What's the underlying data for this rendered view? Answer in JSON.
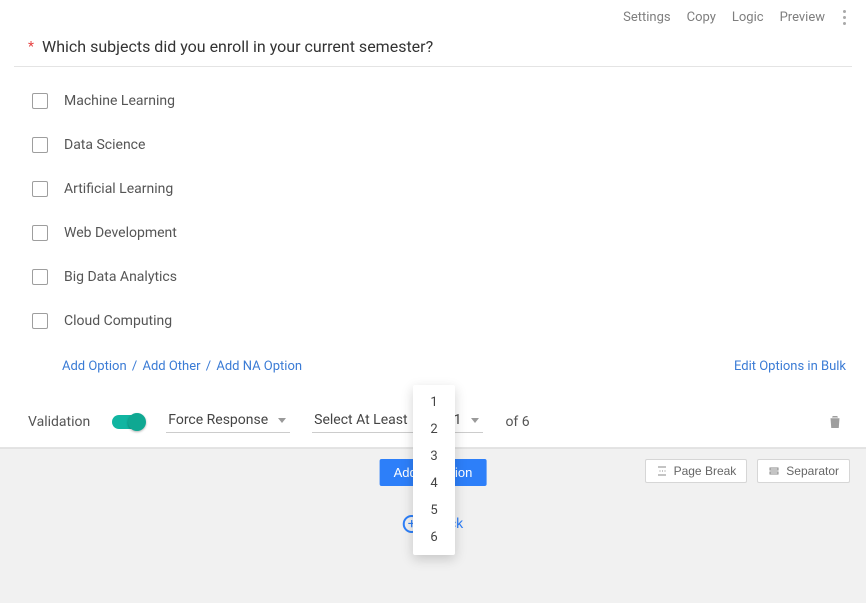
{
  "top_actions": {
    "settings": "Settings",
    "copy": "Copy",
    "logic": "Logic",
    "preview": "Preview"
  },
  "question": {
    "required_marker": "*",
    "text": "Which subjects did you enroll in your current semester?"
  },
  "options": [
    {
      "label": "Machine Learning"
    },
    {
      "label": "Data Science"
    },
    {
      "label": "Artificial Learning"
    },
    {
      "label": "Web Development"
    },
    {
      "label": "Big Data Analytics"
    },
    {
      "label": "Cloud  Computing"
    }
  ],
  "add_links": {
    "add_option": "Add Option",
    "sep": "/",
    "add_other": "Add Other",
    "add_na": "Add NA Option",
    "edit_bulk": "Edit Options in Bulk"
  },
  "validation": {
    "label": "Validation",
    "enabled": true,
    "mode": "Force Response",
    "rule": "Select At Least",
    "count_selected": "1",
    "of_label": "of 6",
    "count_menu": [
      "1",
      "2",
      "3",
      "4",
      "5",
      "6"
    ]
  },
  "lower": {
    "primary_button": "Add Question",
    "page_break": "Page Break",
    "separator": "Separator",
    "center_link": "Block"
  }
}
